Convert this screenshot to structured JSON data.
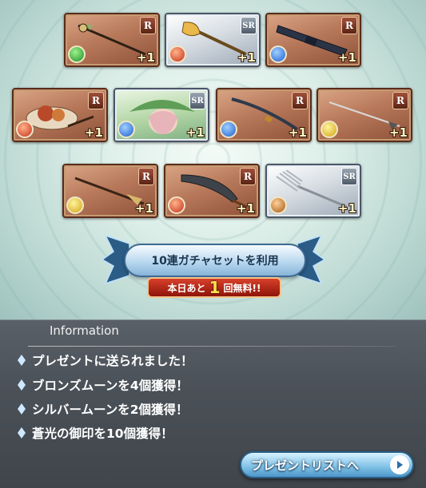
{
  "cards": [
    {
      "rarity": "R",
      "element": "wind",
      "count": "+1",
      "item": "staff"
    },
    {
      "rarity": "SR",
      "element": "fire",
      "count": "+1",
      "item": "golden-axe"
    },
    {
      "rarity": "R",
      "element": "water",
      "count": "+1",
      "item": "gun"
    },
    {
      "rarity": "R",
      "element": "fire",
      "count": "+1",
      "item": "meat-dish"
    },
    {
      "rarity": "SR",
      "element": "water",
      "count": "+1",
      "item": "green-hat-character"
    },
    {
      "rarity": "R",
      "element": "water",
      "count": "+1",
      "item": "katana"
    },
    {
      "rarity": "R",
      "element": "light",
      "count": "+1",
      "item": "spear"
    },
    {
      "rarity": "R",
      "element": "light",
      "count": "+1",
      "item": "lance"
    },
    {
      "rarity": "R",
      "element": "fire",
      "count": "+1",
      "item": "scimitar"
    },
    {
      "rarity": "SR",
      "element": "earth",
      "count": "+1",
      "item": "fork"
    }
  ],
  "gacha": {
    "button_label": "10連ガチャセットを利用",
    "free_prefix": "本日あと",
    "free_count": "1",
    "free_suffix": "回無料!!"
  },
  "info": {
    "title": "Information",
    "messages": [
      "プレゼントに送られました！",
      "ブロンズムーンを4個獲得！",
      "シルバームーンを2個獲得！",
      "蒼光の御印を10個獲得！"
    ],
    "present_button": "プレゼントリストへ"
  }
}
